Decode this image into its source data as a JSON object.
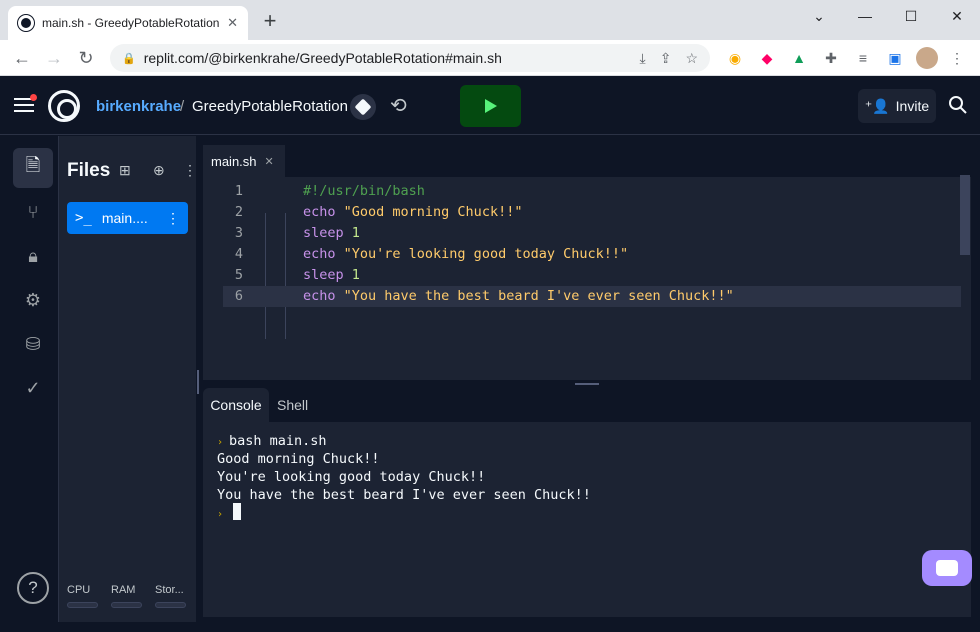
{
  "browser": {
    "tab_title": "main.sh - GreedyPotableRotation",
    "url": "replit.com/@birkenkrahe/GreedyPotableRotation#main.sh",
    "new_tab_label": "+",
    "window_min": "—",
    "window_max": "☐",
    "window_close": "✕",
    "chevron": "⌄"
  },
  "header": {
    "owner": "birkenkrahe",
    "separator": "/",
    "repl_name": "GreedyPotableRotation",
    "invite_label": "Invite"
  },
  "files": {
    "title": "Files",
    "items": [
      {
        "label": "main....",
        "icon": ">_"
      }
    ]
  },
  "resources": {
    "cpu": "CPU",
    "ram": "RAM",
    "storage": "Stor..."
  },
  "editor": {
    "tab_label": "main.sh",
    "lines": [
      {
        "num": "1",
        "parts": [
          {
            "cls": "cm",
            "text": "#!/usr/bin/bash"
          }
        ]
      },
      {
        "num": "2",
        "parts": [
          {
            "cls": "kw",
            "text": "echo"
          },
          {
            "cls": "str",
            "text": " \"Good morning Chuck!!\""
          }
        ]
      },
      {
        "num": "3",
        "parts": [
          {
            "cls": "kw",
            "text": "sleep"
          },
          {
            "cls": "num",
            "text": " 1"
          }
        ]
      },
      {
        "num": "4",
        "parts": [
          {
            "cls": "kw",
            "text": "echo"
          },
          {
            "cls": "str",
            "text": " \"You're looking good today Chuck!!\""
          }
        ]
      },
      {
        "num": "5",
        "parts": [
          {
            "cls": "kw",
            "text": "sleep"
          },
          {
            "cls": "num",
            "text": " 1"
          }
        ]
      },
      {
        "num": "6",
        "parts": [
          {
            "cls": "kw",
            "text": "echo"
          },
          {
            "cls": "str",
            "text": " \"You have the best beard I've ever seen Chuck!!\""
          }
        ]
      }
    ]
  },
  "console": {
    "tabs": [
      "Console",
      "Shell"
    ],
    "command": "bash main.sh",
    "output": [
      "Good morning Chuck!!",
      "You're looking good today Chuck!!",
      "You have the best beard I've ever seen Chuck!!"
    ],
    "prompt_glyph": "›"
  },
  "colors": {
    "accent": "#0079f2",
    "run": "#044a10",
    "background": "#0e1525"
  }
}
